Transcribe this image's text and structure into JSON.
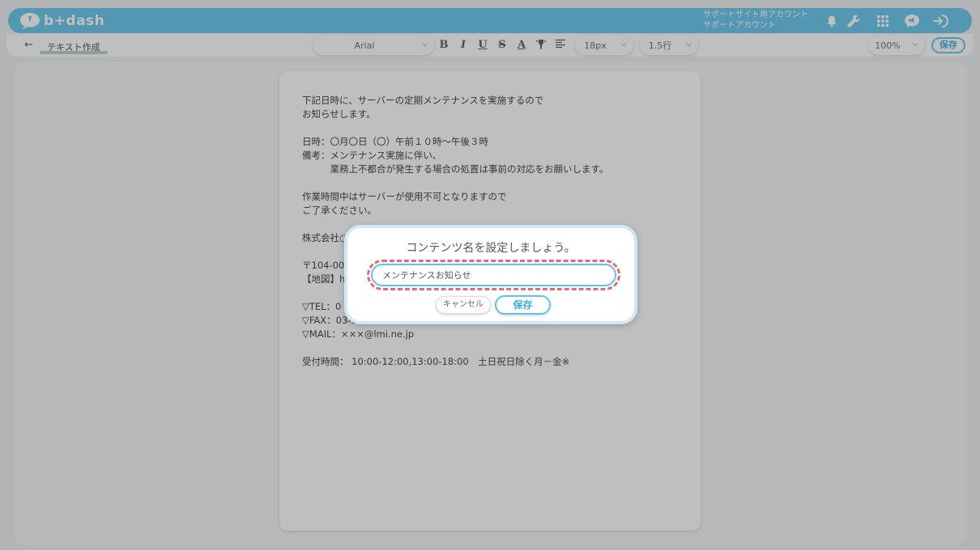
{
  "header": {
    "logo_text": "b+dash",
    "account_line1": "サポートサイト用アカウント",
    "account_line2": "サポートアカウント",
    "icons": [
      "bell-icon",
      "wrench-icon",
      "apps-grid-icon",
      "megaphone-icon",
      "logout-icon"
    ]
  },
  "toolbar": {
    "back_icon": "←",
    "doc_title": "テキスト作成",
    "font_family": "Arial",
    "bold": "B",
    "italic": "I",
    "underline": "U",
    "strike": "S",
    "font_color": "A",
    "font_size": "18px",
    "line_height": "1.5行",
    "zoom": "100%",
    "save_label": "保存"
  },
  "document": {
    "body": "下記日時に、サーバーの定期メンテナンスを実施するので\nお知らせします。\n\n日時：〇月〇日（〇）午前１０時～午後３時\n備考：メンテナンス実施に伴い、\n　　　業務上不都合が発生する場合の処置は事前の対応をお願いします。\n\n作業時間中はサーバーが使用不可となりますので\nご了承ください。\n\n株式会社○\n\n〒104-006\n【地図】h\n\n▽TEL：0\n▽FAX：03-0\n▽MAIL：×××@lmi.ne.jp\n\n受付時間： 10:00-12:00,13:00-18:00　土日祝日除く月－金※"
  },
  "modal": {
    "title": "コンテンツ名を設定しましょう。",
    "input_value": "メンテナンスお知らせ",
    "cancel_label": "キャンセル",
    "save_label": "保存"
  },
  "colors": {
    "accent": "#5ec4ee",
    "highlight_dash": "#e46a78"
  }
}
